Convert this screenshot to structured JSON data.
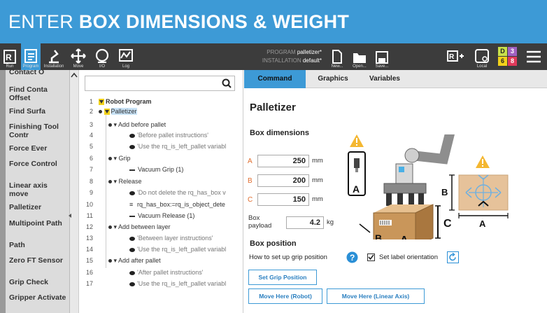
{
  "banner": {
    "prefix": "ENTER ",
    "bold": "BOX DIMENSIONS & WEIGHT"
  },
  "toolbar": {
    "run_label": "Run",
    "program_label": "Program",
    "installation_label": "Installation",
    "move_label": "Move",
    "io_label": "I/O",
    "log_label": "Log",
    "program_key": "PROGRAM",
    "program_value": "palletizer*",
    "installation_key": "INSTALLATION",
    "installation_value": "default*",
    "new_label": "New...",
    "open_label": "Open...",
    "save_label": "Save...",
    "local_label": "Local",
    "badge_d": "D",
    "badge_3": "3",
    "badge_6": "6",
    "badge_8": "8"
  },
  "commands": [
    "Contact O",
    "Find Conta Offset",
    "Find Surfa",
    "Finishing Tool Contr",
    "Force Ever",
    "Force Control",
    "Linear axis move",
    "Palletizer",
    "Multipoint Path",
    "Path",
    "Zero FT Sensor",
    "Grip Check",
    "Gripper Activate"
  ],
  "tree": {
    "rows": [
      {
        "n": "1",
        "text": "Robot Program"
      },
      {
        "n": "2",
        "text": "Palletizer"
      },
      {
        "n": "3",
        "text": "Add before pallet"
      },
      {
        "n": "4",
        "text": "'Before pallet instructions'"
      },
      {
        "n": "5",
        "text": "'Use the rq_is_left_pallet variabl"
      },
      {
        "n": "6",
        "text": "Grip"
      },
      {
        "n": "7",
        "text": "Vacuum Grip  (1)"
      },
      {
        "n": "8",
        "text": "Release"
      },
      {
        "n": "9",
        "text": "'Do not delete the rq_has_box v"
      },
      {
        "n": "10",
        "text": "rq_has_box:=rq_is_object_dete"
      },
      {
        "n": "11",
        "text": "Vacuum Release  (1)"
      },
      {
        "n": "12",
        "text": "Add between layer"
      },
      {
        "n": "13",
        "text": "'Between layer instructions'"
      },
      {
        "n": "14",
        "text": "'Use the rq_is_left_pallet variabl"
      },
      {
        "n": "15",
        "text": "Add after pallet"
      },
      {
        "n": "16",
        "text": "'After pallet instructions'"
      },
      {
        "n": "17",
        "text": "'Use the rq_is_left_pallet variabl"
      }
    ]
  },
  "tabs": {
    "command": "Command",
    "graphics": "Graphics",
    "variables": "Variables"
  },
  "panel": {
    "title": "Palletizer",
    "box_dimensions": "Box dimensions",
    "a_label": "A",
    "a_value": "250",
    "a_unit": "mm",
    "b_label": "B",
    "b_value": "200",
    "b_unit": "mm",
    "c_label": "C",
    "c_value": "150",
    "c_unit": "mm",
    "payload_label": "Box payload",
    "payload_value": "4.2",
    "payload_unit": "kg",
    "box_position": "Box position",
    "grip_question": "How to set up grip position",
    "label_orientation": "Set label orientation",
    "set_grip": "Set Grip Position",
    "move_robot": "Move Here (Robot)",
    "move_linear": "Move Here (Linear Axis)"
  },
  "illustration": {
    "a": "A",
    "b": "B",
    "c": "C"
  },
  "colors": {
    "accent": "#3d9ad6",
    "highlight": "#f2d21a",
    "dim_label": "#e06c2c",
    "warning": "#f4b731"
  }
}
